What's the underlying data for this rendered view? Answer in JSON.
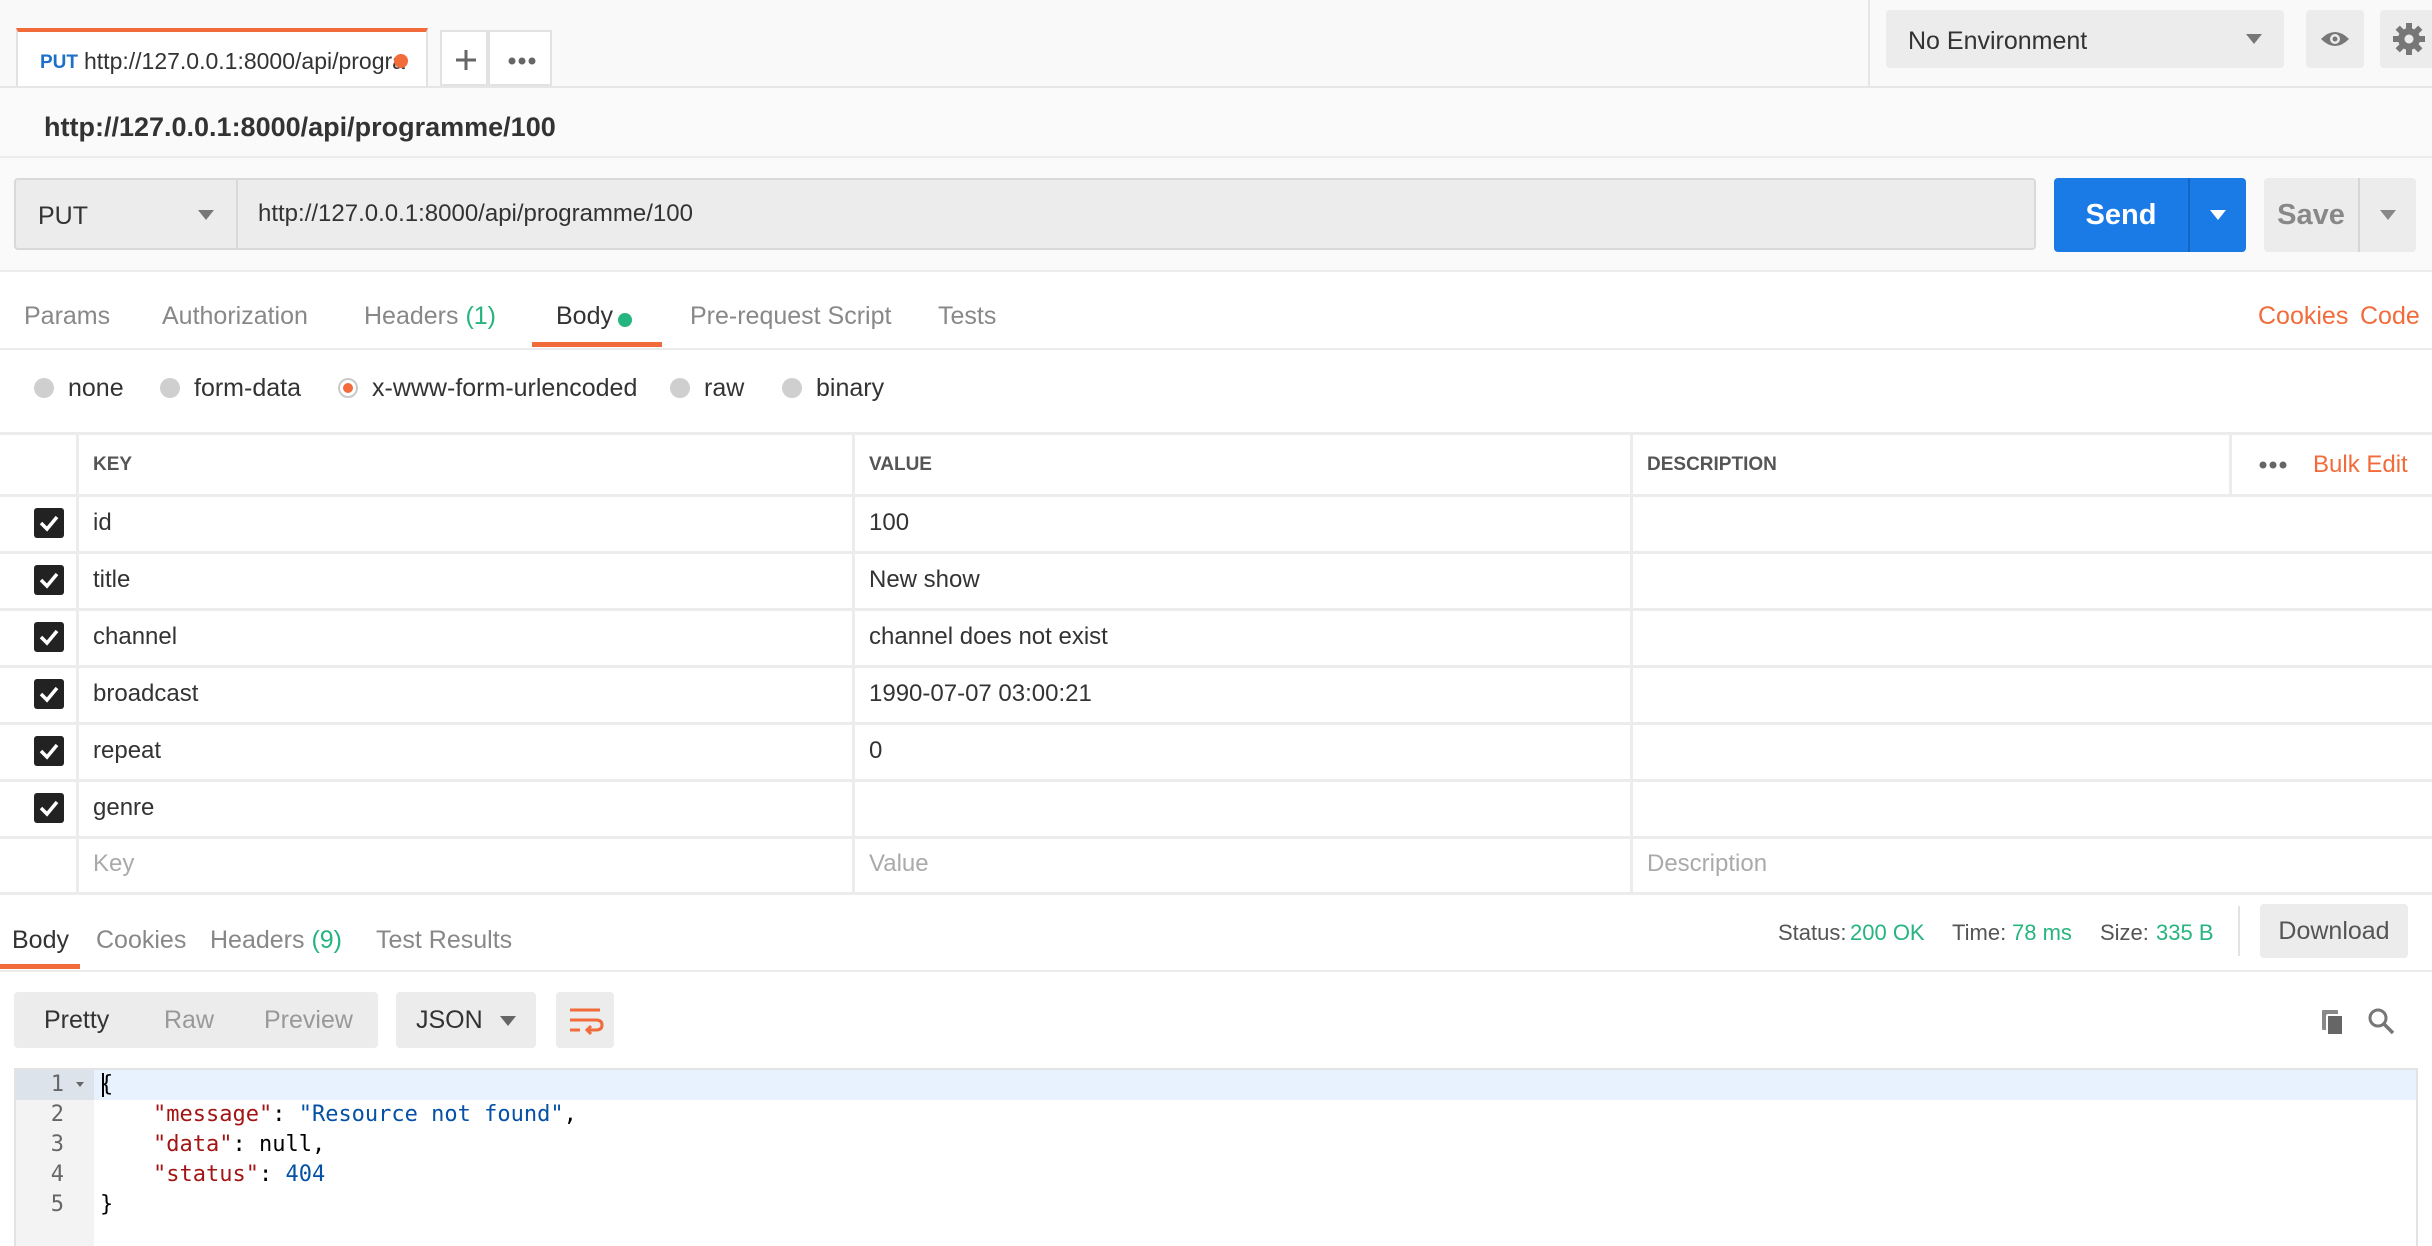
{
  "tab": {
    "method": "PUT",
    "url": "http://127.0.0.1:8000/api/progra"
  },
  "environment": {
    "selected": "No Environment"
  },
  "title": "http://127.0.0.1:8000/api/programme/100",
  "request": {
    "method": "PUT",
    "url": "http://127.0.0.1:8000/api/programme/100",
    "send_label": "Send",
    "save_label": "Save"
  },
  "request_tabs": {
    "params": "Params",
    "authorization": "Authorization",
    "headers": "Headers",
    "headers_count": "(1)",
    "body": "Body",
    "prerequest": "Pre-request Script",
    "tests": "Tests",
    "cookies": "Cookies",
    "code": "Code"
  },
  "body_types": {
    "none": "none",
    "form_data": "form-data",
    "urlencoded": "x-www-form-urlencoded",
    "raw": "raw",
    "binary": "binary",
    "selected": "x-www-form-urlencoded"
  },
  "table": {
    "headers": {
      "key": "KEY",
      "value": "VALUE",
      "description": "DESCRIPTION",
      "bulk_edit": "Bulk Edit"
    },
    "rows": [
      {
        "key": "id",
        "value": "100",
        "checked": true
      },
      {
        "key": "title",
        "value": "New show",
        "checked": true
      },
      {
        "key": "channel",
        "value": "channel does not exist",
        "checked": true
      },
      {
        "key": "broadcast",
        "value": "1990-07-07 03:00:21",
        "checked": true
      },
      {
        "key": "repeat",
        "value": "0",
        "checked": true
      },
      {
        "key": "genre",
        "value": "",
        "checked": true
      }
    ],
    "placeholders": {
      "key": "Key",
      "value": "Value",
      "description": "Description"
    }
  },
  "response": {
    "tabs": {
      "body": "Body",
      "cookies": "Cookies",
      "headers": "Headers",
      "headers_count": "(9)",
      "test_results": "Test Results"
    },
    "status_label": "Status:",
    "status": "200 OK",
    "time_label": "Time:",
    "time": "78 ms",
    "size_label": "Size:",
    "size": "335 B",
    "download_label": "Download",
    "formats": {
      "pretty": "Pretty",
      "raw": "Raw",
      "preview": "Preview"
    },
    "language": "JSON",
    "line_numbers": [
      "1",
      "2",
      "3",
      "4",
      "5"
    ],
    "json": {
      "open": "{",
      "message_key": "\"message\"",
      "message_val": "\"Resource not found\"",
      "data_key": "\"data\"",
      "data_val": "null",
      "status_key": "\"status\"",
      "status_val": "404",
      "close": "}"
    }
  },
  "colors": {
    "accent": "#f26b3a",
    "send": "#1a7be7",
    "success": "#26b47f"
  }
}
